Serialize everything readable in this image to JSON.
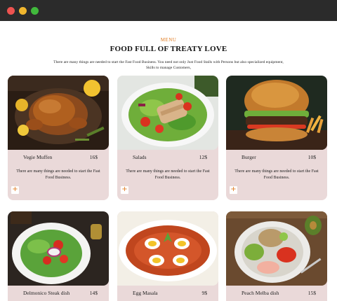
{
  "window": {
    "controls": [
      "close",
      "minimize",
      "zoom"
    ]
  },
  "section": {
    "kicker": "MENU",
    "title": "FOOD FULL OF TREATY LOVE",
    "description": "There are many things are needed to start the Fast Food Business. You need not only Just Food Stalls with Persons but also specialized equipment, Skills to manage Customers,"
  },
  "items": [
    {
      "name": "Vegie Muffen",
      "price": "16$",
      "description": "There are many things are needed to start the Fast Food Business.",
      "add": "+",
      "image": "roast-chicken-image"
    },
    {
      "name": "Salads",
      "price": "12$",
      "description": "There are many things are needed to start the Fast Food Business.",
      "add": "+",
      "image": "chicken-salad-image"
    },
    {
      "name": "Burger",
      "price": "10$",
      "description": "There are many things are needed to start the Fast Food Business.",
      "add": "+",
      "image": "burger-image"
    },
    {
      "name": "Delmonico Steak dish",
      "price": "14$",
      "image": "steak-salad-image"
    },
    {
      "name": "Egg Masala",
      "price": "9$",
      "image": "egg-masala-image"
    },
    {
      "name": "Peach Melba dish",
      "price": "15$",
      "image": "buddha-bowl-image"
    }
  ],
  "colors": {
    "accent": "#e07a1f",
    "card_bg": "#ead9d9",
    "titlebar": "#2b2b2b"
  }
}
